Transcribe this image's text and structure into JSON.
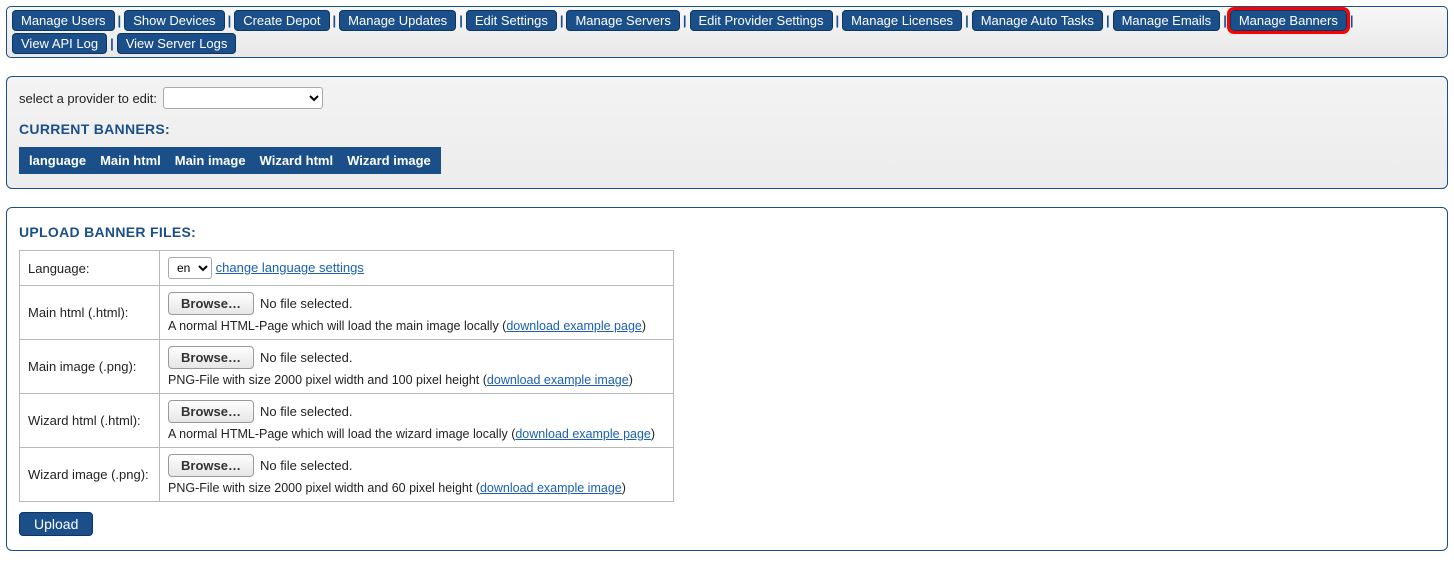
{
  "nav": {
    "items": [
      {
        "label": "Manage Users",
        "highlight": false
      },
      {
        "label": "Show Devices",
        "highlight": false
      },
      {
        "label": "Create Depot",
        "highlight": false
      },
      {
        "label": "Manage Updates",
        "highlight": false
      },
      {
        "label": "Edit Settings",
        "highlight": false
      },
      {
        "label": "Manage Servers",
        "highlight": false
      },
      {
        "label": "Edit Provider Settings",
        "highlight": false
      },
      {
        "label": "Manage Licenses",
        "highlight": false
      },
      {
        "label": "Manage Auto Tasks",
        "highlight": false
      },
      {
        "label": "Manage Emails",
        "highlight": false
      },
      {
        "label": "Manage Banners",
        "highlight": true
      },
      {
        "label": "View API Log",
        "highlight": false
      },
      {
        "label": "View Server Logs",
        "highlight": false
      }
    ]
  },
  "provider": {
    "label": "select a provider to edit:",
    "value": ""
  },
  "current_banners": {
    "title": "CURRENT BANNERS:",
    "columns": [
      "language",
      "Main html",
      "Main image",
      "Wizard html",
      "Wizard image"
    ]
  },
  "upload": {
    "title": "UPLOAD BANNER FILES:",
    "button_label": "Upload",
    "browse_label": "Browse…",
    "no_file_label": "No file selected.",
    "rows": [
      {
        "label": "Language:",
        "kind": "lang",
        "lang_value": "en",
        "change_link": "change language settings"
      },
      {
        "label": "Main html (.html):",
        "kind": "file",
        "help_pre": "A normal HTML-Page which will load the main image locally (",
        "help_link": "download example page",
        "help_post": ")"
      },
      {
        "label": "Main image (.png):",
        "kind": "file",
        "help_pre": "PNG-File with size 2000 pixel width and 100 pixel height (",
        "help_link": "download example image",
        "help_post": ")"
      },
      {
        "label": "Wizard html (.html):",
        "kind": "file",
        "help_pre": "A normal HTML-Page which will load the wizard image locally (",
        "help_link": "download example page",
        "help_post": ")"
      },
      {
        "label": "Wizard image (.png):",
        "kind": "file",
        "help_pre": "PNG-File with size 2000 pixel width and 60 pixel height (",
        "help_link": "download example image",
        "help_post": ")"
      }
    ]
  }
}
